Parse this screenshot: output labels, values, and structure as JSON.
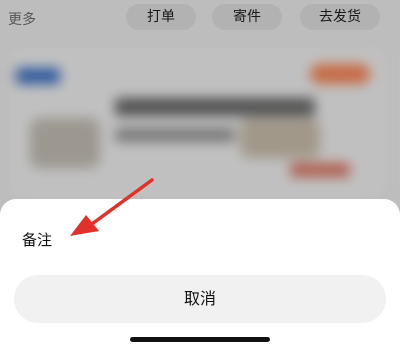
{
  "header": {
    "more_label": "更多",
    "actions": [
      "打单",
      "寄件",
      "去发货"
    ]
  },
  "action_sheet": {
    "items": [
      "备注"
    ],
    "cancel_label": "取消"
  },
  "colors": {
    "annotation_arrow": "#e0322b",
    "sheet_background": "#ffffff",
    "cancel_background": "#f1f1f1"
  }
}
